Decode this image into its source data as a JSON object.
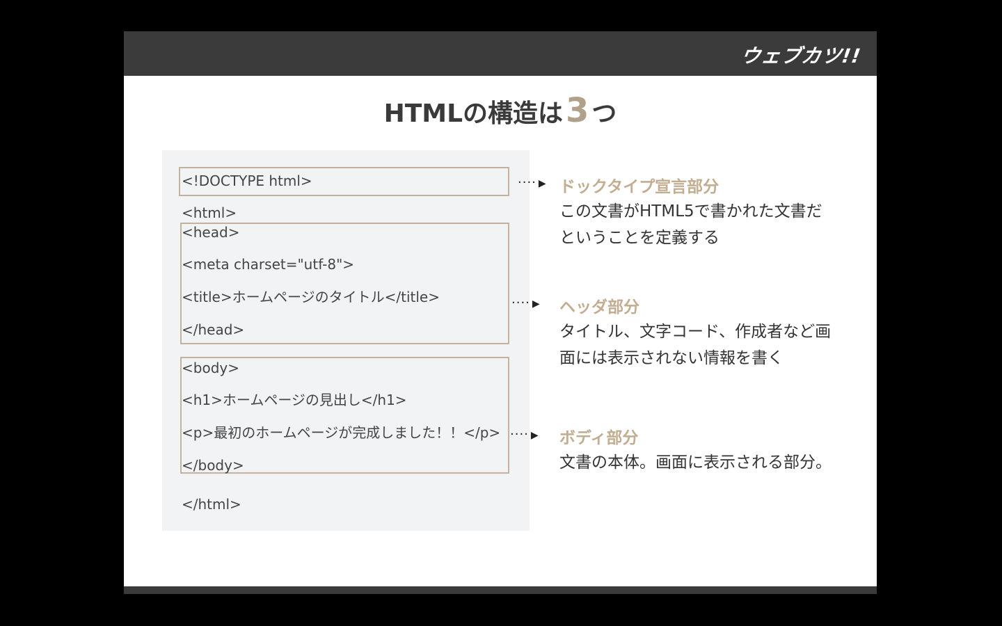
{
  "header": {
    "logo": "ウェブカツ!!"
  },
  "title": {
    "prefix": "HTMLの構造は",
    "number": "3",
    "suffix": "つ"
  },
  "code": {
    "doctype": "<!DOCTYPE html>",
    "html_open": "<html>",
    "head_open": "<head>",
    "meta": "<meta charset=\"utf-8\">",
    "title_tag": "<title>ホームページのタイトル</title>",
    "head_close": "</head>",
    "body_open": "<body>",
    "h1": "<h1>ホームページの見出し</h1>",
    "p": "<p>最初のホームページが完成しました！！</p>",
    "body_close": "</body>",
    "html_close": "</html>"
  },
  "annotations": {
    "arrow_glyph": "····",
    "doctype": {
      "heading": "ドックタイプ宣言部分",
      "line1": "この文書がHTML5で書かれた文書だ",
      "line2": "ということを定義する"
    },
    "head": {
      "heading": "ヘッダ部分",
      "line1": "タイトル、文字コード、作成者など画",
      "line2": "面には表示されない情報を書く"
    },
    "body": {
      "heading": "ボディ部分",
      "line1": "文書の本体。画面に表示される部分。"
    }
  },
  "colors": {
    "accent": "#c3ad91",
    "box_border": "#c3b39c",
    "bar": "#3b3b3b",
    "code_panel": "#f2f3f4"
  }
}
